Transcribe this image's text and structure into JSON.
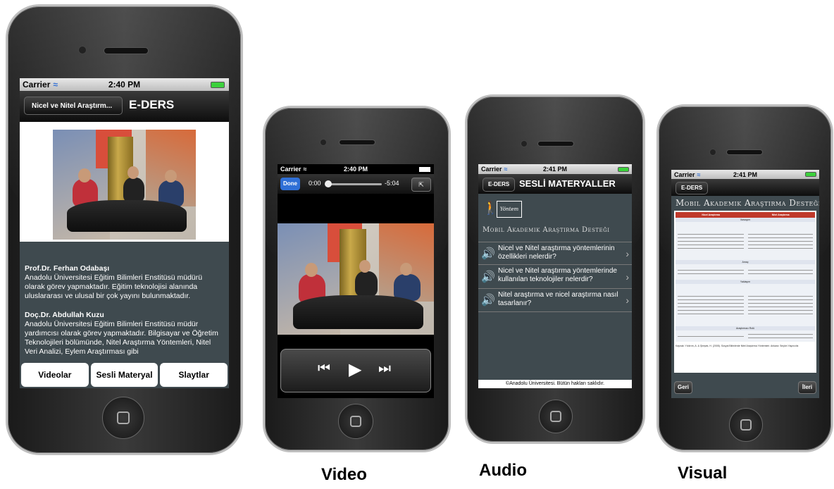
{
  "phone1": {
    "status": {
      "carrier": "Carrier",
      "time": "2:40 PM"
    },
    "back_label": "Nicel ve Nitel Araştırm...",
    "title": "E-DERS",
    "bio1_name": "Prof.Dr. Ferhan Odabaşı",
    "bio1_text": "Anadolu Üniversitesi Eğitim Bilimleri Enstitüsü müdürü olarak görev yapmaktadır. Eğitim teknolojisi alanında uluslararası ve ulusal bir çok yayını bulunmaktadır.",
    "bio2_name": "Doç.Dr. Abdullah Kuzu",
    "bio2_text": "Anadolu Üniversitesi Eğitim Bilimleri Enstitüsü müdür yardımcısı olarak görev yapmaktadır. Bilgisayar ve Öğretim Teknolojileri bölümünde, Nitel Araştırma Yöntemleri, Nitel Veri Analizi, Eylem Araştırması gibi",
    "tabs": [
      "Videolar",
      "Sesli Materyal",
      "Slaytlar"
    ]
  },
  "phone2": {
    "status": {
      "carrier": "Carrier",
      "time": "2:40 PM"
    },
    "done_label": "Done",
    "elapsed": "0:00",
    "remaining": "-5:04",
    "caption": "Video",
    "progress": 0.05
  },
  "phone3": {
    "status": {
      "carrier": "Carrier",
      "time": "2:41 PM"
    },
    "back_label": "E-DERS",
    "title": "SESLİ MATERYALLER",
    "logo_text": "Yöntem",
    "brand": "Mobil Akademik Araştırma Desteği",
    "items": [
      "Nicel ve Nitel araştırma yöntemlerinin özellikleri nelerdir?",
      "Nicel ve Nitel araştırma yöntemlerinde kullanılan teknolojiler nelerdir?",
      "Nitel araştırma ve nicel araştırma nasıl tasarlanır?"
    ],
    "footer": "©Anadolu Üniversitesi. Bütün hakları saklıdır.",
    "caption": "Audio"
  },
  "phone4": {
    "status": {
      "carrier": "Carrier",
      "time": "2:41 PM"
    },
    "back_label": "E-DERS",
    "brand": "Mobil Akademik Araştırma Desteği",
    "table_headers": [
      "Nicel Araştırma",
      "Nitel Araştırma"
    ],
    "sections": [
      "Varsayım",
      "Amaç",
      "Yaklaşım",
      "Araştırmacı Rolü"
    ],
    "source": "Kaynak: Yıldırım, A. & Şimşek, H. (2005). Sosyal Bilimlerde Nitel Araştırma Yöntemleri. Ankara: Seçkin Yayıncılık",
    "prev_label": "Geri",
    "next_label": "İleri",
    "caption": "Visual"
  },
  "colors": {
    "accent_blue": "#2f6fd6",
    "battery_green": "#3cd13c",
    "table_red": "#c0392b",
    "screen_bg": "#3f4a4f"
  }
}
